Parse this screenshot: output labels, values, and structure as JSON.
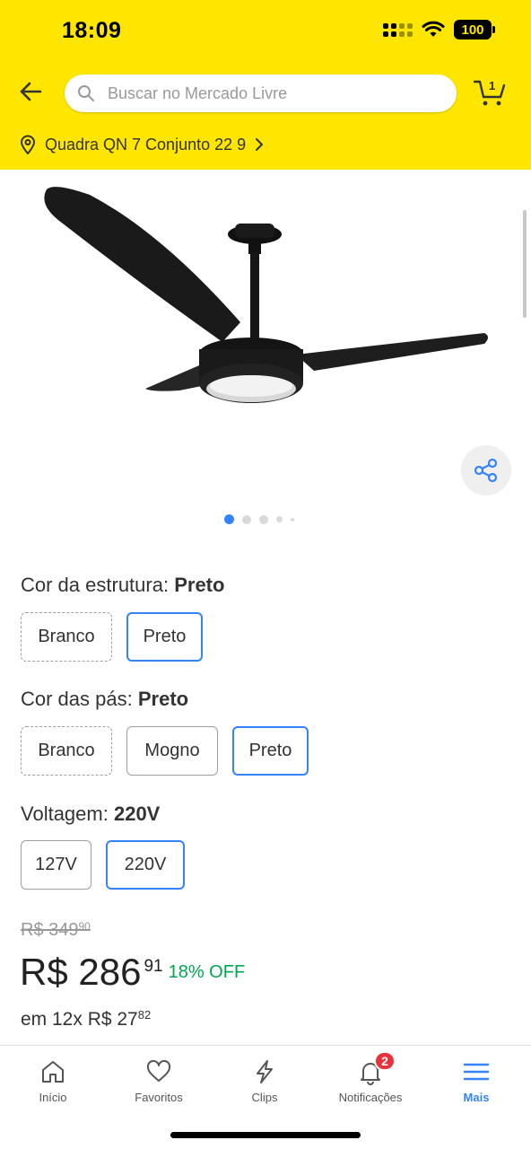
{
  "status_bar": {
    "time": "18:09",
    "battery": "100"
  },
  "search": {
    "placeholder": "Buscar no Mercado Livre"
  },
  "cart": {
    "count": "1"
  },
  "location": {
    "text": "Quadra QN 7 Conjunto 22 9"
  },
  "gallery": {
    "active_index": 0,
    "dot_count": 5
  },
  "variations": {
    "structure_color": {
      "label": "Cor da estrutura:",
      "selected": "Preto",
      "options": [
        "Branco",
        "Preto"
      ]
    },
    "blade_color": {
      "label": "Cor das pás:",
      "selected": "Preto",
      "options": [
        "Branco",
        "Mogno",
        "Preto"
      ]
    },
    "voltage": {
      "label": "Voltagem:",
      "selected": "220V",
      "options": [
        "127V",
        "220V"
      ]
    }
  },
  "price": {
    "old_price": "R$ 349",
    "old_cents": "90",
    "current": "R$ 286",
    "current_cents": "91",
    "discount": "18% OFF",
    "installments": "em 12x R$ 27",
    "installment_cents": "82"
  },
  "bottom_nav": {
    "items": [
      {
        "label": "Início",
        "icon": "home-icon"
      },
      {
        "label": "Favoritos",
        "icon": "heart-icon"
      },
      {
        "label": "Clips",
        "icon": "lightning-icon"
      },
      {
        "label": "Notificações",
        "icon": "bell-icon",
        "badge": "2"
      },
      {
        "label": "Mais",
        "icon": "menu-icon"
      }
    ],
    "active_index": 4
  },
  "colors": {
    "brand_yellow": "#fee600",
    "accent_blue": "#3483fa",
    "discount_green": "#00a650",
    "badge_red": "#e8333d"
  }
}
